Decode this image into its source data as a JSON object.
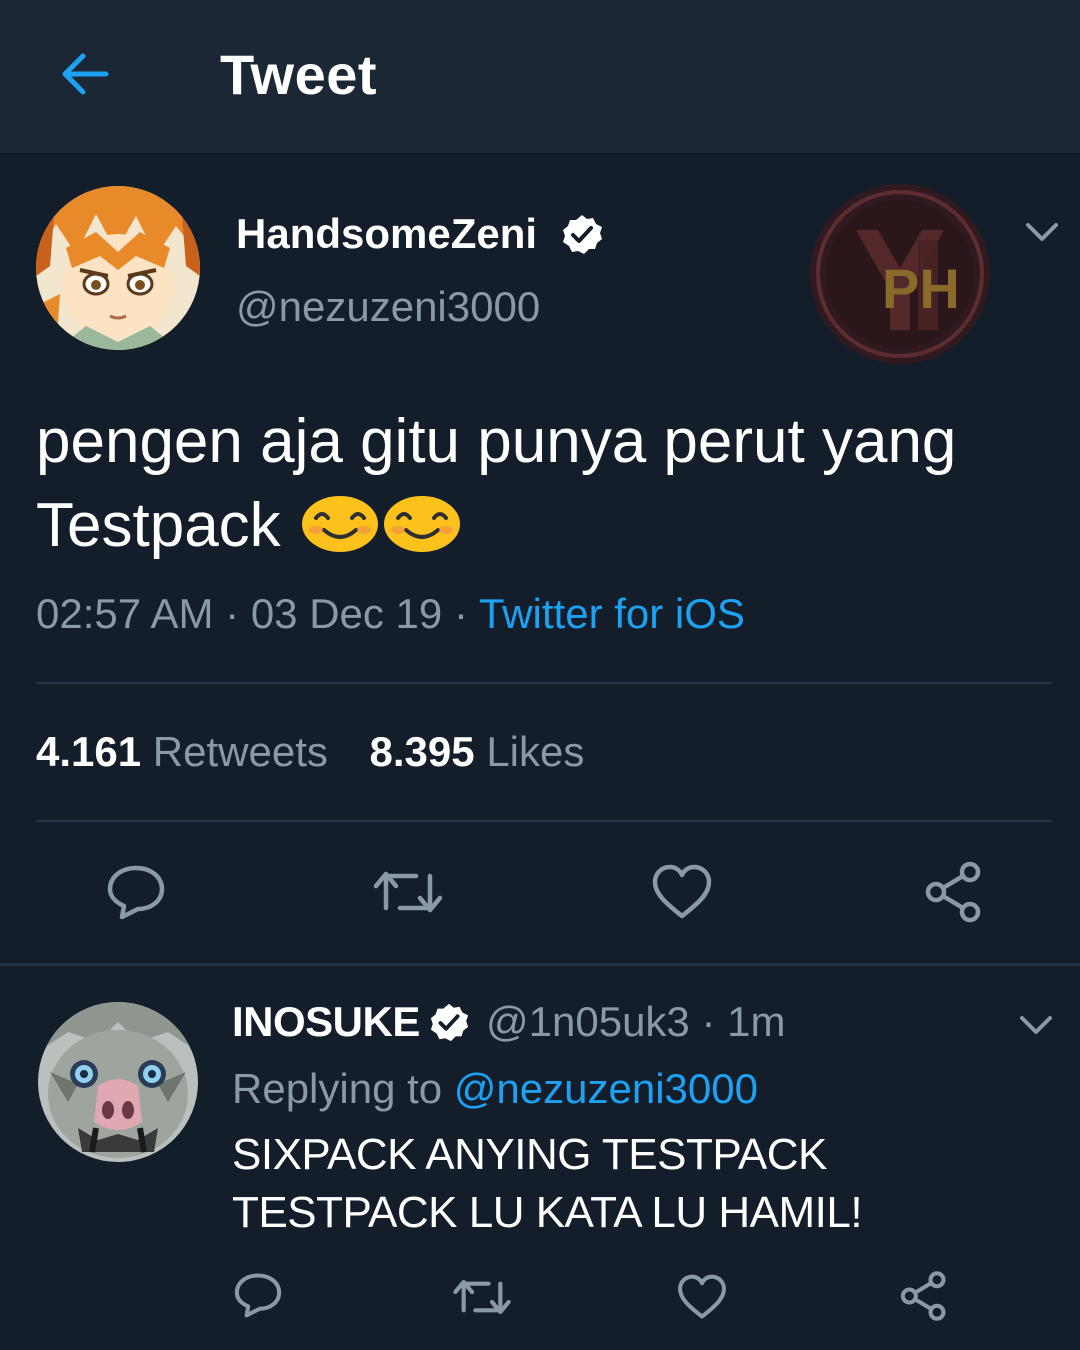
{
  "header": {
    "title": "Tweet"
  },
  "tweet": {
    "display_name": "HandsomeZeni",
    "handle": "@nezuzeni3000",
    "text": "pengen aja gitu punya perut yang Testpack",
    "emoji": [
      "smiling-face-icon",
      "smiling-face-icon"
    ],
    "time": "02:57 AM",
    "date": "03 Dec 19",
    "separator": "·",
    "source": "Twitter for iOS",
    "retweets_count": "4.161",
    "retweets_label": "Retweets",
    "likes_count": "8.395",
    "likes_label": "Likes"
  },
  "watermark": {
    "letters": "PH"
  },
  "reply": {
    "display_name": "INOSUKE",
    "handle_time": "@1n05uk3 · 1m",
    "replying_prefix": "Replying to",
    "replying_to": "@nezuzeni3000",
    "text": "SIXPACK ANYING TESTPACK TESTPACK LU KATA LU HAMIL!"
  },
  "colors": {
    "background": "#141d2a",
    "header": "#1b2735",
    "accent": "#1da1f2",
    "muted": "#8b98a5"
  }
}
